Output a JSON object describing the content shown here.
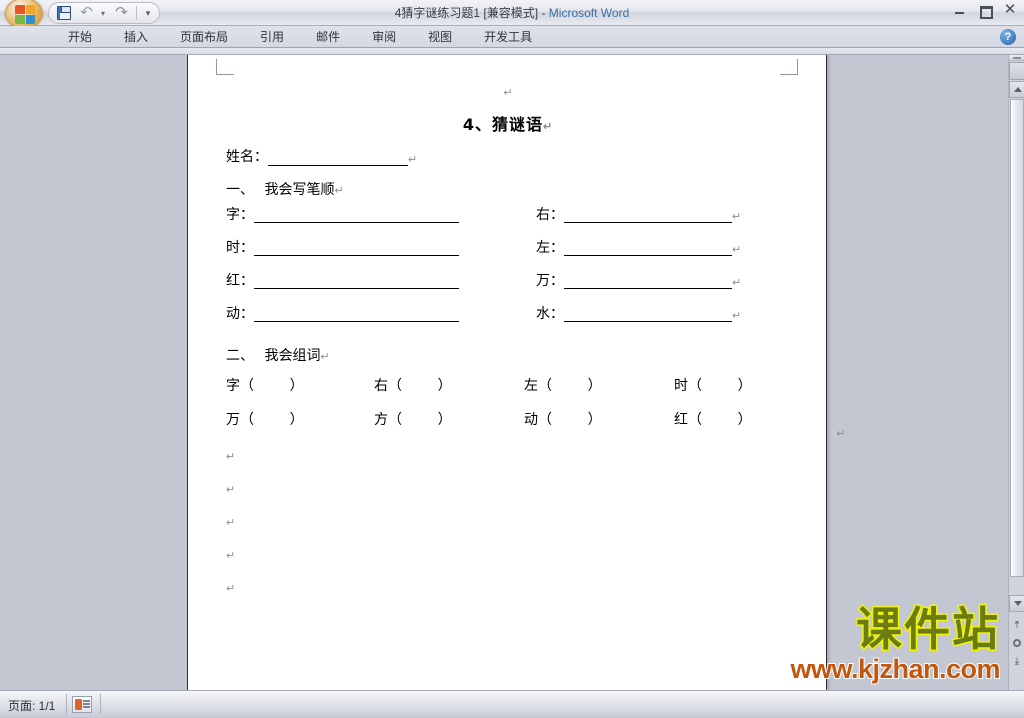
{
  "window": {
    "title_doc": "4猜字谜练习题1 [兼容模式]",
    "title_sep": " - ",
    "title_app": "Microsoft Word",
    "minimize": "Minimize",
    "restore": "Restore",
    "close": "✕",
    "help": "?"
  },
  "quick_access": {
    "office_button": "Office",
    "save": "save-icon",
    "undo": "↶",
    "undo_drop": "▾",
    "redo": "↷",
    "customize": "▾"
  },
  "ribbon": {
    "tabs": [
      {
        "label": "开始"
      },
      {
        "label": "插入"
      },
      {
        "label": "页面布局"
      },
      {
        "label": "引用"
      },
      {
        "label": "邮件"
      },
      {
        "label": "审阅"
      },
      {
        "label": "视图"
      },
      {
        "label": "开发工具"
      }
    ]
  },
  "document": {
    "pilcrow": "↵",
    "title": "4、猜谜语",
    "name_label": "姓名：",
    "section1": {
      "number": "一、",
      "label": "我会写笔顺"
    },
    "stroke_rows": [
      {
        "left": "字：",
        "right": "右："
      },
      {
        "left": "时：",
        "right": "左："
      },
      {
        "left": "红：",
        "right": "万："
      },
      {
        "left": "动：",
        "right": "水："
      }
    ],
    "section2": {
      "number": "二、",
      "label": "我会组词"
    },
    "word_rows": [
      [
        "字（        ）",
        "右（        ）",
        "左（        ）",
        "时（        ）"
      ],
      [
        "万（        ）",
        "方（        ）",
        "动（        ）",
        "红（        ）"
      ]
    ],
    "empty_paragraph_count": 5
  },
  "watermark": {
    "text_cn": "课件站",
    "text_url": "www.kjzhan.com",
    "color_cn": "#6b7d12",
    "color_cn_stroke": "#f2f20a",
    "color_url": "#c1560e"
  },
  "status_bar": {
    "page_label": "页面: 1/1",
    "view_icon": "page-view-icon"
  },
  "scrollbar": {
    "split_handle": "split-handle",
    "browse_object": "select-browse-object",
    "up": "▲",
    "down": "▼",
    "prev_page": "⤒",
    "next_page": "⤓"
  },
  "colors": {
    "workspace": "#c3c7d1",
    "page": "#ffffff",
    "title_app": "#3a6ea5"
  }
}
